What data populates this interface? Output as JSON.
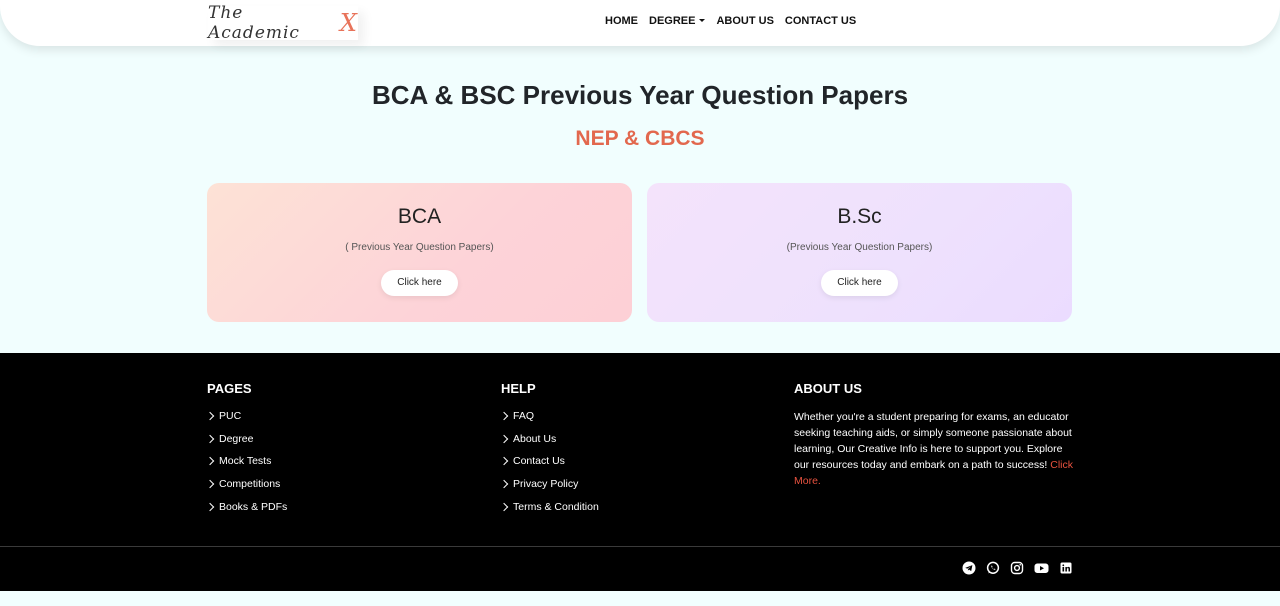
{
  "nav": {
    "brand_text": "The Academic",
    "brand_x": "X",
    "links": [
      "HOME",
      "DEGREE",
      "ABOUT US",
      "CONTACT US"
    ]
  },
  "hero": {
    "title": "BCA & BSC Previous Year Question Papers",
    "subtitle": "NEP & CBCS"
  },
  "cards": [
    {
      "title": "BCA",
      "desc": "( Previous Year Question Papers)",
      "button": "Click here"
    },
    {
      "title": "B.Sc",
      "desc": "(Previous Year Question Papers)",
      "button": "Click here"
    }
  ],
  "footer": {
    "pages": {
      "heading": "PAGES",
      "items": [
        "PUC",
        "Degree",
        "Mock Tests",
        "Competitions",
        "Books & PDFs"
      ]
    },
    "help": {
      "heading": "HELP",
      "items": [
        "FAQ",
        "About Us",
        "Contact Us",
        "Privacy Policy",
        "Terms & Condition"
      ]
    },
    "about": {
      "heading": "ABOUT US",
      "text": "Whether you're a student preparing for exams, an educator seeking teaching aids, or simply someone passionate about learning, Our Creative Info is here to support you. Explore our resources today and embark on a path to success! ",
      "more": "Click More."
    },
    "socials": [
      "telegram-icon",
      "whatsapp-icon",
      "instagram-icon",
      "youtube-icon",
      "linkedin-icon"
    ]
  },
  "colors": {
    "accent": "#e2684e",
    "footer_bg": "#000000",
    "page_bg": "#f1fefe"
  }
}
